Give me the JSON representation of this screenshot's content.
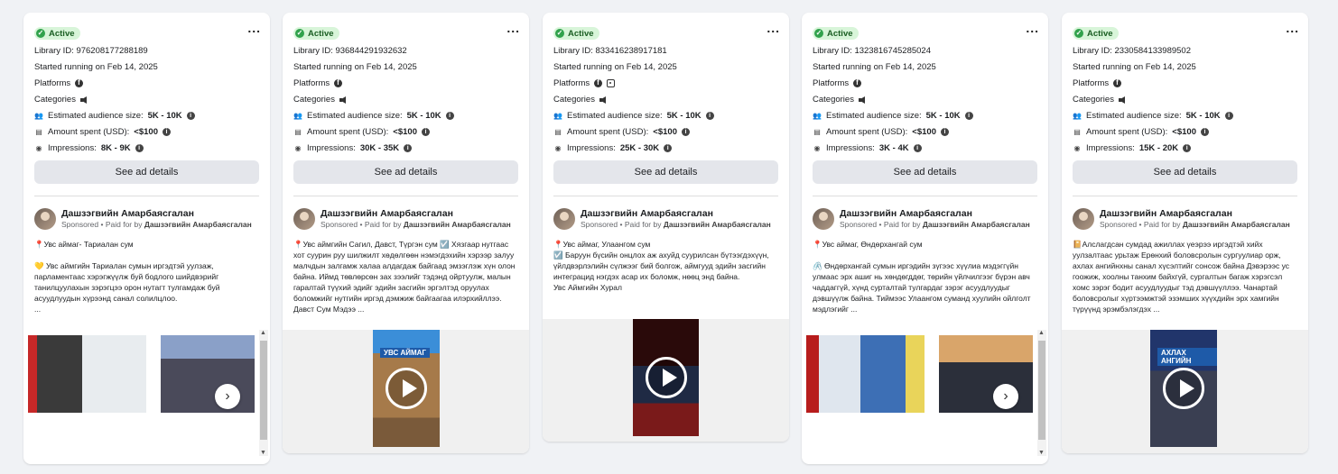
{
  "common": {
    "status": "Active",
    "more": "...",
    "started": "Started running on Feb 14, 2025",
    "platforms_label": "Platforms",
    "categories_label": "Categories",
    "audience_label": "Estimated audience size:",
    "spent_label": "Amount spent (USD):",
    "impressions_label": "Impressions:",
    "details_btn": "See ad details",
    "advertiser": "Дашзэгвийн Амарбаясгалан",
    "sponsored": "Sponsored",
    "paid_for_by": "Paid for by",
    "next": "›"
  },
  "cards": [
    {
      "library_id": "Library ID: 976208177288189",
      "platforms": [
        "facebook-icon"
      ],
      "audience": "5K - 10K",
      "spent": "<$100",
      "impressions": "8K - 9K",
      "text": "📍Увс аймаг- Тариалан сум\n\n💛 Увс аймгийн Тариалан сумын иргэдтэй уулзаж, парламентаас хэрэгжүүлж буй бодлого шийдвэрийг танилцуулахын зэрэгцээ орон нутагт тулгамдаж буй асуудлуудын хүрээнд санал солилцлоо.\n..."
    },
    {
      "library_id": "Library ID: 936844291932632",
      "platforms": [
        "facebook-icon"
      ],
      "audience": "5K - 10K",
      "spent": "<$100",
      "impressions": "30K - 35K",
      "text": "📍Увс аймгийн Сагил, Давст, Түргэн сум ☑️ Хязгаар нутгаас хот суурин руу шилжилт хөдөлгөөн нэмэгдэхийн хэрээр залуу малчдын залгамж халаа алдагдаж байгаад эмзэглэж хүн олон байна. Иймд төвлөрсөн зах зээлийг тэдэнд ойртуулж, малын гаралтай түүхий эдийг эдийн засгийн эргэлтэд оруулах боломжийг нутгийн иргэд дэмжиж байгаагаа илэрхийллээ. Давст Сум Мэдээ ..."
    },
    {
      "library_id": "Library ID: 833416238917181",
      "platforms": [
        "facebook-icon",
        "instagram-icon"
      ],
      "audience": "5K - 10K",
      "spent": "<$100",
      "impressions": "25K - 30K",
      "text": "📍Увс аймаг, Улаангом сум\n☑️ Баруун бүсийн онцлох аж ахуйд суурилсан бүтээгдэхүүн, үйлдвэрлэлийн сүлжээг бий болгож, аймгууд эдийн засгийн интеграцид нэгдэх асар их боломж, нөөц энд байна.\nУвс Аймгийн Хурал"
    },
    {
      "library_id": "Library ID: 1323816745285024",
      "platforms": [
        "facebook-icon"
      ],
      "audience": "5K - 10K",
      "spent": "<$100",
      "impressions": "3K - 4K",
      "text": "📍Увс аймаг, Өндөрхангай сум\n\n🖇️ Өндөрхангай сумын иргэдийн зүгээс хүүлиа мэдэггүйн улмаас эрх ашиг нь хөндөгддөг, төрийн үйлчилгээг бүрэн авч чаддаггүй, хүнд сурталтай тулгардаг зэрэг асуудлуудыг дэвшүүлж байна. Тиймээс Улаангом суманд хуулийн  ойлголт мэдлэгийг ..."
    },
    {
      "library_id": "Library ID: 2330584133989502",
      "platforms": [
        "facebook-icon"
      ],
      "audience": "5K - 10K",
      "spent": "<$100",
      "impressions": "15K - 20K",
      "text": "📔Алслагдсан сумдад ажиллах үеэрээ иргэдтэй хийх уулзалтаас урьтаж Ерөнхий боловсролын сургуулиар орж, ахлах ангийнхны санал хүсэлтийг сонсож байна Дэвэрээс ус гоожиж, хоолны танхим байхгүй, сургалтын багаж хэрэгсэл хомс зэрэг бодит асуудлуудыг тэд дэвшүүллээ. Чанартай боловсролыг хүртээмжтэй эзэмших хүүхдийн эрх хамгийн түрүүнд эрэмбэлэгдэх ..."
    }
  ],
  "media": {
    "video_banner": "УВС АЙМАГ",
    "video_banner_2": "АХЛАХ АНГИЙН"
  }
}
